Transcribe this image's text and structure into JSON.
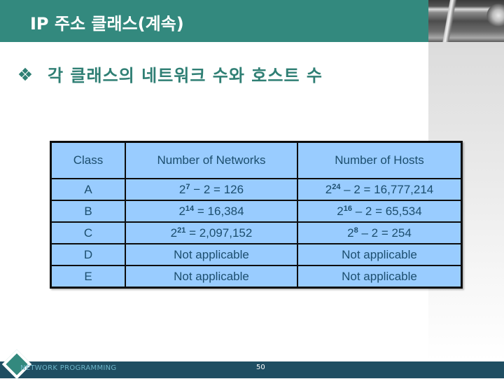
{
  "header": {
    "title": "IP 주소 클래스(계속)"
  },
  "subtitle": {
    "bullet_icon": "diamond-bullet-icon",
    "text": "각 클래스의 네트워크 수와 호스트 수"
  },
  "table": {
    "headers": [
      "Class",
      "Number of Networks",
      "Number of Hosts"
    ],
    "rows": [
      {
        "class": "A",
        "networks": {
          "base": "2",
          "exp": "7",
          "rest": " − 2 = 126"
        },
        "hosts": {
          "base": "2",
          "exp": "24",
          "rest": " – 2 = 16,777,214"
        }
      },
      {
        "class": "B",
        "networks": {
          "base": "2",
          "exp": "14",
          "rest": " = 16,384"
        },
        "hosts": {
          "base": "2",
          "exp": "16",
          "rest": " – 2 = 65,534"
        }
      },
      {
        "class": "C",
        "networks": {
          "base": "2",
          "exp": "21",
          "rest": " = 2,097,152"
        },
        "hosts": {
          "base": "2",
          "exp": "8",
          "rest": " – 2 = 254"
        }
      },
      {
        "class": "D",
        "networks": {
          "text": "Not applicable"
        },
        "hosts": {
          "text": "Not applicable"
        }
      },
      {
        "class": "E",
        "networks": {
          "text": "Not applicable"
        },
        "hosts": {
          "text": "Not applicable"
        }
      }
    ]
  },
  "footer": {
    "logo_icon": "diamond-logo-icon",
    "label": "NETWORK PROGRAMMING",
    "page_number": "50"
  },
  "colors": {
    "title_bar": "#33897e",
    "subtitle_text": "#2f7f74",
    "table_fill": "#99ccff",
    "table_text": "#1c4e6e",
    "footer_bar": "#1f4e62",
    "footer_text": "#6fb6c9"
  }
}
